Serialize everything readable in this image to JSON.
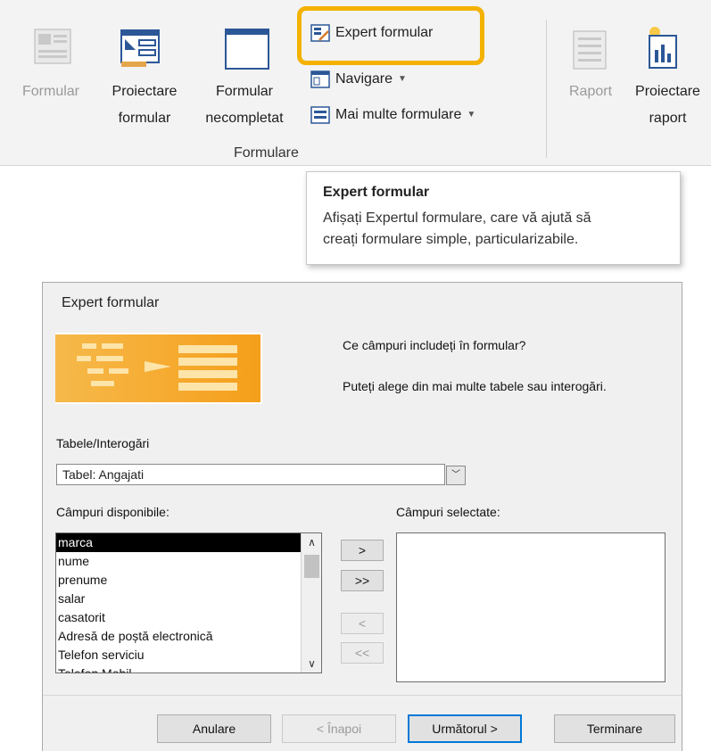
{
  "ribbon": {
    "formular": "Formular",
    "proiectare_formular": [
      "Proiectare",
      "formular"
    ],
    "formular_necompletat": [
      "Formular",
      "necompletat"
    ],
    "expert_formular": "Expert formular",
    "navigare": "Navigare",
    "mai_multe_formulare": "Mai multe formulare",
    "group_label": "Formulare",
    "raport": "Raport",
    "proiectare_raport": [
      "Proiectare",
      "raport"
    ],
    "highlight_color": "#f5b100"
  },
  "tooltip": {
    "title": "Expert formular",
    "line1": "Afișați Expertul formulare, care vă ajută să",
    "line2": "creați formulare simple, particularizabile."
  },
  "dialog": {
    "title": "Expert formular",
    "question": "Ce câmpuri includeți în formular?",
    "hint": "Puteți alege din mai multe tabele sau interogări.",
    "tables_label": "Tabele/Interogări",
    "table_selected": "Tabel: Angajati",
    "available_label": "Câmpuri disponibile:",
    "selected_label": "Câmpuri selectate:",
    "available_fields": [
      "marca",
      "nume",
      "prenume",
      "salar",
      "casatorit",
      "Adresă de poștă electronică",
      "Telefon serviciu",
      "Telefon Mobil"
    ],
    "move_one": ">",
    "move_all": ">>",
    "remove_one": "<",
    "remove_all": "<<",
    "cancel": "Anulare",
    "back": "< Înapoi",
    "next": "Următorul >",
    "finish": "Terminare"
  }
}
